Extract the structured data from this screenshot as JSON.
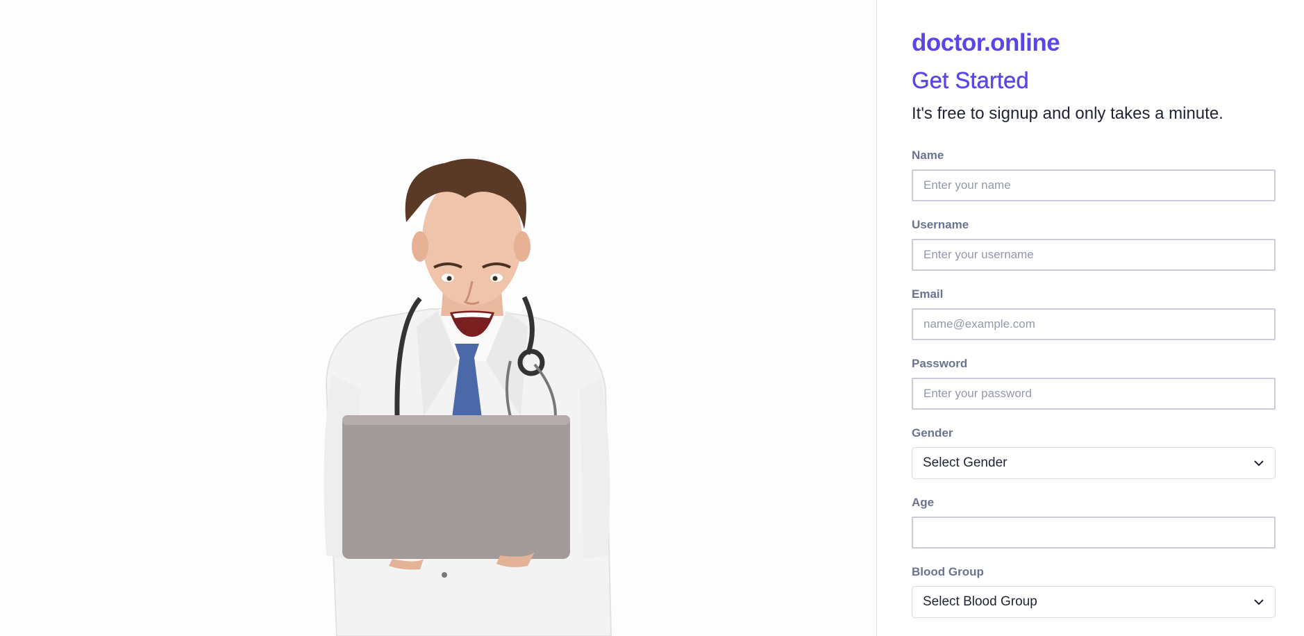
{
  "brand": "doctor.online",
  "heading": "Get Started",
  "subheading": "It's free to signup and only takes a minute.",
  "form": {
    "name": {
      "label": "Name",
      "placeholder": "Enter your name",
      "value": ""
    },
    "username": {
      "label": "Username",
      "placeholder": "Enter your username",
      "value": ""
    },
    "email": {
      "label": "Email",
      "placeholder": "name@example.com",
      "value": ""
    },
    "password": {
      "label": "Password",
      "placeholder": "Enter your password",
      "value": ""
    },
    "gender": {
      "label": "Gender",
      "selected": "Select Gender"
    },
    "age": {
      "label": "Age",
      "placeholder": "",
      "value": ""
    },
    "blood_group": {
      "label": "Blood Group",
      "selected": "Select Blood Group"
    }
  },
  "colors": {
    "accent": "#5a46e8",
    "label": "#6b7390",
    "text": "#1f2333",
    "input_border": "#c9cbd8"
  },
  "icons": {
    "select_arrow": "chevron-down-icon",
    "hero": "doctor-with-laptop-illustration"
  }
}
